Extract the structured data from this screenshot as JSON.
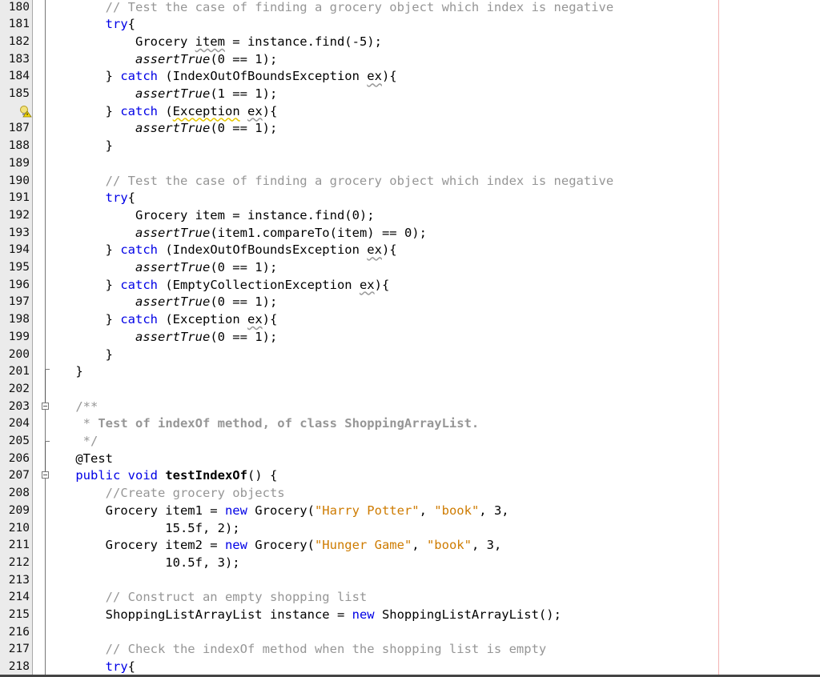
{
  "editor": {
    "lines": [
      {
        "n": "180",
        "tokens": [
          [
            "cm",
            "        // Test the case of finding a grocery object which index is negative"
          ]
        ]
      },
      {
        "n": "181",
        "tokens": [
          [
            "",
            "        "
          ],
          [
            "kw",
            "try"
          ],
          [
            "",
            "{"
          ]
        ]
      },
      {
        "n": "182",
        "tokens": [
          [
            "",
            "            Grocery "
          ],
          [
            "wavy",
            "item"
          ],
          [
            "",
            " = instance.find(-5);"
          ]
        ]
      },
      {
        "n": "183",
        "tokens": [
          [
            "",
            "            "
          ],
          [
            "it",
            "assertTrue"
          ],
          [
            "",
            "(0 == 1);"
          ]
        ]
      },
      {
        "n": "184",
        "tokens": [
          [
            "",
            "        } "
          ],
          [
            "kw",
            "catch"
          ],
          [
            "",
            " (IndexOutOfBoundsException "
          ],
          [
            "wavy",
            "ex"
          ],
          [
            "",
            "){"
          ]
        ]
      },
      {
        "n": "185",
        "tokens": [
          [
            "",
            "            "
          ],
          [
            "it",
            "assertTrue"
          ],
          [
            "",
            "(1 == 1);"
          ]
        ]
      },
      {
        "n": "",
        "tokens": [
          [
            "",
            "        } "
          ],
          [
            "kw",
            "catch"
          ],
          [
            "",
            " ("
          ],
          [
            "wavyy",
            "Exception"
          ],
          [
            "",
            " "
          ],
          [
            "wavy",
            "ex"
          ],
          [
            "",
            "){"
          ]
        ]
      },
      {
        "n": "187",
        "tokens": [
          [
            "",
            "            "
          ],
          [
            "it",
            "assertTrue"
          ],
          [
            "",
            "(0 == 1);"
          ]
        ]
      },
      {
        "n": "188",
        "tokens": [
          [
            "",
            "        }"
          ]
        ]
      },
      {
        "n": "189",
        "tokens": []
      },
      {
        "n": "190",
        "tokens": [
          [
            "cm",
            "        // Test the case of finding a grocery object which index is negative"
          ]
        ]
      },
      {
        "n": "191",
        "tokens": [
          [
            "",
            "        "
          ],
          [
            "kw",
            "try"
          ],
          [
            "",
            "{"
          ]
        ]
      },
      {
        "n": "192",
        "tokens": [
          [
            "",
            "            Grocery item = instance.find(0);"
          ]
        ]
      },
      {
        "n": "193",
        "tokens": [
          [
            "",
            "            "
          ],
          [
            "it",
            "assertTrue"
          ],
          [
            "",
            "(item1.compareTo(item) == 0);"
          ]
        ]
      },
      {
        "n": "194",
        "tokens": [
          [
            "",
            "        } "
          ],
          [
            "kw",
            "catch"
          ],
          [
            "",
            " (IndexOutOfBoundsException "
          ],
          [
            "wavy",
            "ex"
          ],
          [
            "",
            "){"
          ]
        ]
      },
      {
        "n": "195",
        "tokens": [
          [
            "",
            "            "
          ],
          [
            "it",
            "assertTrue"
          ],
          [
            "",
            "(0 == 1);"
          ]
        ]
      },
      {
        "n": "196",
        "tokens": [
          [
            "",
            "        } "
          ],
          [
            "kw",
            "catch"
          ],
          [
            "",
            " (EmptyCollectionException "
          ],
          [
            "wavy",
            "ex"
          ],
          [
            "",
            "){"
          ]
        ]
      },
      {
        "n": "197",
        "tokens": [
          [
            "",
            "            "
          ],
          [
            "it",
            "assertTrue"
          ],
          [
            "",
            "(0 == 1);"
          ]
        ]
      },
      {
        "n": "198",
        "tokens": [
          [
            "",
            "        } "
          ],
          [
            "kw",
            "catch"
          ],
          [
            "",
            " (Exception "
          ],
          [
            "wavy",
            "ex"
          ],
          [
            "",
            "){"
          ]
        ]
      },
      {
        "n": "199",
        "tokens": [
          [
            "",
            "            "
          ],
          [
            "it",
            "assertTrue"
          ],
          [
            "",
            "(0 == 1);"
          ]
        ]
      },
      {
        "n": "200",
        "tokens": [
          [
            "",
            "        }"
          ]
        ]
      },
      {
        "n": "201",
        "tokens": [
          [
            "",
            "    }"
          ]
        ]
      },
      {
        "n": "202",
        "tokens": []
      },
      {
        "n": "203",
        "tokens": [
          [
            "doc",
            "    /**"
          ]
        ]
      },
      {
        "n": "204",
        "tokens": [
          [
            "doc",
            "     * "
          ],
          [
            "docb",
            "Test of indexOf method, of class ShoppingArrayList."
          ]
        ]
      },
      {
        "n": "205",
        "tokens": [
          [
            "doc",
            "     */"
          ]
        ]
      },
      {
        "n": "206",
        "tokens": [
          [
            "",
            "    @Test"
          ]
        ]
      },
      {
        "n": "207",
        "tokens": [
          [
            "kw",
            "    public void "
          ],
          [
            "b",
            "testIndexOf"
          ],
          [
            "",
            "() {"
          ]
        ]
      },
      {
        "n": "208",
        "tokens": [
          [
            "cm",
            "        //Create grocery objects"
          ]
        ]
      },
      {
        "n": "209",
        "tokens": [
          [
            "",
            "        Grocery item1 = "
          ],
          [
            "kw",
            "new"
          ],
          [
            "",
            " Grocery("
          ],
          [
            "str",
            "\"Harry Potter\""
          ],
          [
            "",
            ", "
          ],
          [
            "str",
            "\"book\""
          ],
          [
            "",
            ", 3,"
          ]
        ]
      },
      {
        "n": "210",
        "tokens": [
          [
            "",
            "                15.5f, 2);"
          ]
        ]
      },
      {
        "n": "211",
        "tokens": [
          [
            "",
            "        Grocery item2 = "
          ],
          [
            "kw",
            "new"
          ],
          [
            "",
            " Grocery("
          ],
          [
            "str",
            "\"Hunger Game\""
          ],
          [
            "",
            ", "
          ],
          [
            "str",
            "\"book\""
          ],
          [
            "",
            ", 3,"
          ]
        ]
      },
      {
        "n": "212",
        "tokens": [
          [
            "",
            "                10.5f, 3);"
          ]
        ]
      },
      {
        "n": "213",
        "tokens": []
      },
      {
        "n": "214",
        "tokens": [
          [
            "cm",
            "        // Construct an empty shopping list"
          ]
        ]
      },
      {
        "n": "215",
        "tokens": [
          [
            "",
            "        ShoppingListArrayList instance = "
          ],
          [
            "kw",
            "new"
          ],
          [
            "",
            " ShoppingListArrayList();"
          ]
        ]
      },
      {
        "n": "216",
        "tokens": []
      },
      {
        "n": "217",
        "tokens": [
          [
            "cm",
            "        // Check the indexOf method when the shopping list is empty"
          ]
        ]
      },
      {
        "n": "218",
        "tokens": [
          [
            "",
            "        "
          ],
          [
            "kw",
            "try"
          ],
          [
            "",
            "{"
          ]
        ]
      }
    ],
    "hint_icon": "lightbulb-warning-icon",
    "hint_line": "186"
  }
}
